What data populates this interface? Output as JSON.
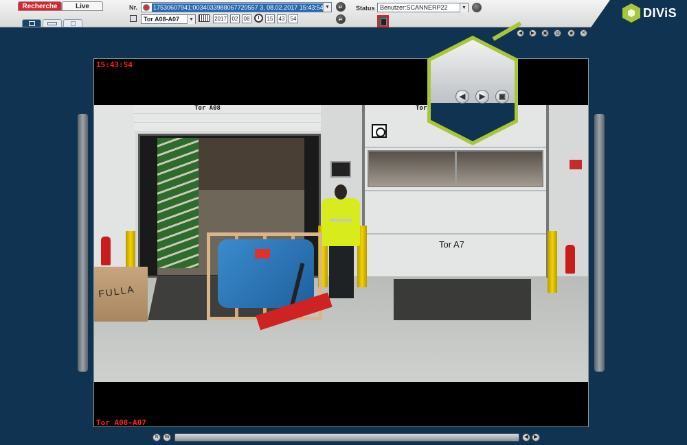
{
  "tabs": {
    "recherche": "Recherche",
    "live": "Live"
  },
  "toolbar": {
    "nr_label": "Nr.",
    "nr_value": "17530607941:0034033988067720557 3, 08.02.2017 15:43:54",
    "camera_select": "Tor A08-A07",
    "date": {
      "year": "2017",
      "month": "02",
      "day": "08"
    },
    "time": {
      "hour": "15",
      "minute": "43",
      "second": "54"
    },
    "status_label": "Status",
    "user_select": "Benutzer:SCANNERP22"
  },
  "logo": {
    "text": "DIViS",
    "brand_color": "#a8c63a"
  },
  "video": {
    "timestamp": "15:43:54",
    "camera_name": "Tor A08-A07",
    "door_label_left": "Tor A08",
    "door_label_right": "Tor",
    "door_sign": "Tor A7",
    "box_text": "FULLA"
  },
  "camera_tools": [
    "arrow-left-icon",
    "arrow-right-icon",
    "camera-icon",
    "print-icon",
    "settings-icon",
    "mail-icon"
  ],
  "callout": {
    "buttons": [
      "arrow-left-icon",
      "arrow-right-icon",
      "camera-icon"
    ]
  },
  "bottom": {
    "h_label": "h",
    "m_label": "m"
  }
}
